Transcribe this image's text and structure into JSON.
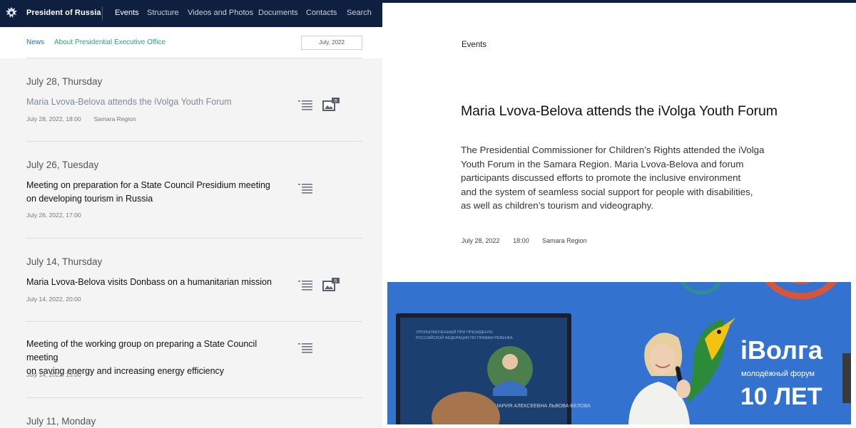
{
  "header": {
    "site_name": "President of Russia",
    "nav": [
      "Events",
      "Structure",
      "Videos and Photos",
      "Documents",
      "Contacts",
      "Search"
    ]
  },
  "subnav": {
    "links": [
      "News",
      "About Presidential Executive Office"
    ],
    "date_filter": "July, 2022"
  },
  "feed": {
    "days": [
      "July 28, Thursday",
      "July 26, Tuesday",
      "July 14, Thursday",
      "July 11, Monday"
    ],
    "items": [
      {
        "title_lines": [
          "Maria Lvova-Belova attends the iVolga Youth Forum"
        ],
        "datetime": "July 28, 2022, 18:00",
        "region": "Samara Region",
        "photo_count": "9"
      },
      {
        "title_lines": [
          "Meeting on preparation for a State Council Presidium meeting",
          "on developing tourism in Russia"
        ],
        "datetime": "July 26, 2022, 17:00"
      },
      {
        "title_lines": [
          "Maria Lvova-Belova visits Donbass on a humanitarian mission"
        ],
        "datetime": "July 14, 2022, 20:00",
        "photo_count": "5"
      },
      {
        "title_lines": [
          "Meeting of the working group on preparing a State Council meeting",
          "on saving energy and increasing energy efficiency"
        ],
        "datetime": "July 14, 2022, 15:00"
      }
    ]
  },
  "article": {
    "section": "Events",
    "title": "Maria Lvova-Belova attends the iVolga Youth Forum",
    "lead_lines": [
      "The Presidential Commissioner for Children’s Rights attended the iVolga",
      "Youth Forum in the Samara Region. Maria Lvova-Belova and forum",
      "participants discussed efforts to promote the inclusive environment",
      "and the system of seamless social support for people with disabilities,",
      "as well as children’s tourism and videography."
    ],
    "date": "July 28, 2022",
    "time": "18:00",
    "region": "Samara Region"
  },
  "photo": {
    "screen_lines": [
      "УПОЛНОМОЧЕННЫЙ ПРИ ПРЕЗИДЕНТЕ",
      "РОССИЙСКОЙ ФЕДЕРАЦИИ ПО ПРАВАМ РЕБЕНКА"
    ],
    "screen_name": "МАРИЯ АЛЕКСЕЕВНА ЛЬВОВА-БЕЛОВА",
    "banner_brand": "iВолга",
    "banner_sub": "молодёжный форум",
    "banner_years": "10 ЛЕТ"
  },
  "colors": {
    "header_bg": "#0e1f3f",
    "link": "#1f6fa8",
    "link_alt": "#2aa380",
    "banner_blue": "#2f6cc7",
    "accent_orange": "#e8532a"
  },
  "icons": [
    "emblem-icon",
    "text-document-icon",
    "photo-gallery-icon"
  ]
}
